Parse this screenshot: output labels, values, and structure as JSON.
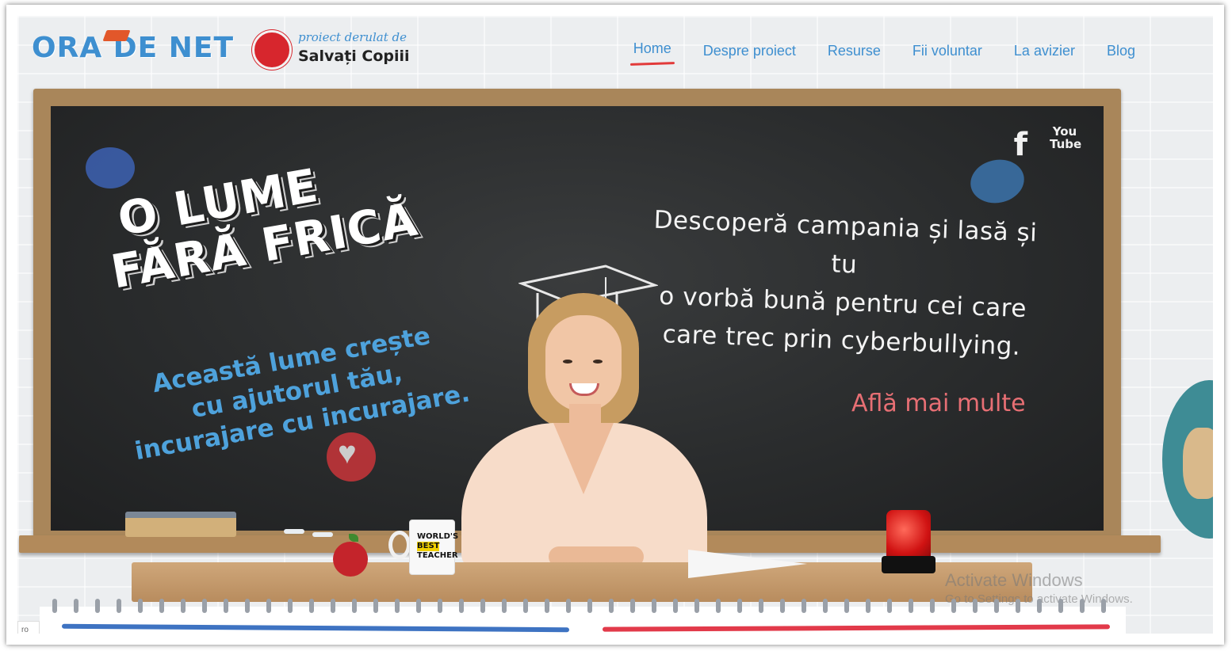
{
  "header": {
    "logo_text": "ORA DE NET",
    "partner_small": "proiect derulat de",
    "partner_name": "Salvați Copiii"
  },
  "nav": {
    "items": [
      {
        "label": "Home",
        "active": true
      },
      {
        "label": "Despre proiect",
        "active": false
      },
      {
        "label": "Resurse",
        "active": false
      },
      {
        "label": "Fii voluntar",
        "active": false
      },
      {
        "label": "La avizier",
        "active": false
      },
      {
        "label": "Blog",
        "active": false
      }
    ]
  },
  "hero": {
    "headline_line1": "O LUME",
    "headline_line2": "FĂRĂ FRICĂ",
    "subline_line1": "Această lume crește",
    "subline_line2": "cu ajutorul tău,",
    "subline_line3": "incurajare cu incurajare.",
    "tagline_line1": "Descoperă campania și lasă și tu",
    "tagline_line2": "o vorbă bună pentru cei care",
    "tagline_line3": "care trec prin cyberbullying.",
    "cta_label": "Află mai multe"
  },
  "social": {
    "facebook_glyph": "f",
    "youtube_line1": "You",
    "youtube_line2": "Tube"
  },
  "props": {
    "mug_line1": "WORLD'S",
    "mug_line2": "BEST",
    "mug_line3": "TEACHER"
  },
  "os_watermark": {
    "line1": "Activate Windows",
    "line2": "Go to Settings to activate Windows."
  },
  "footer": {
    "language": "ro"
  },
  "colors": {
    "brand_blue": "#3e8fd0",
    "accent_red": "#e23a3a",
    "chalkboard": "#2a2c2d",
    "cta_pink": "#e76f74"
  }
}
